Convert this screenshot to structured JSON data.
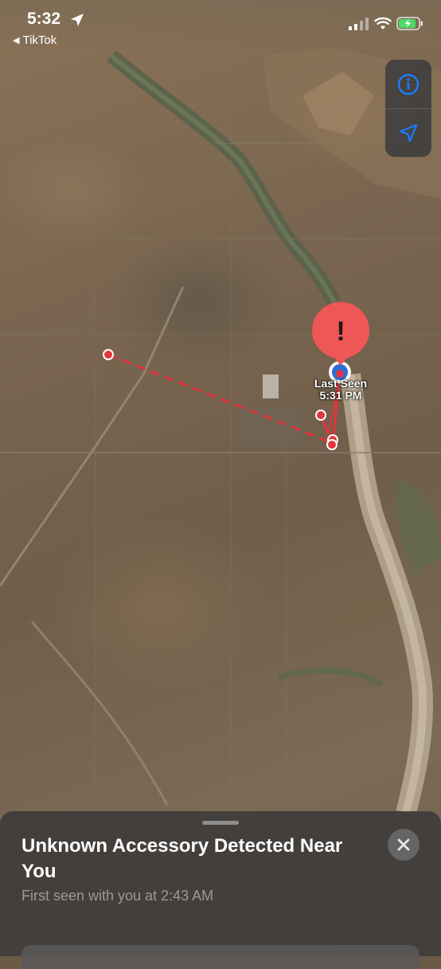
{
  "status_bar": {
    "time": "5:32",
    "back_app": "TikTok",
    "battery_state": "charging",
    "colors": {
      "battery": "#4cd964"
    }
  },
  "map": {
    "controls": [
      {
        "icon": "info-icon"
      },
      {
        "icon": "location-arrow-icon"
      }
    ],
    "colors": {
      "path": "#e0353d",
      "pin": "#ef5656",
      "controls_icon": "#1c7cff"
    },
    "last_seen": {
      "line1": "Last Seen",
      "line2": "5:31 PM"
    },
    "alert_pin_glyph": "!"
  },
  "sheet": {
    "title": "Unknown Accessory Detected Near You",
    "subtitle": "First seen with you at 2:43 AM",
    "close_icon": "close-icon"
  }
}
